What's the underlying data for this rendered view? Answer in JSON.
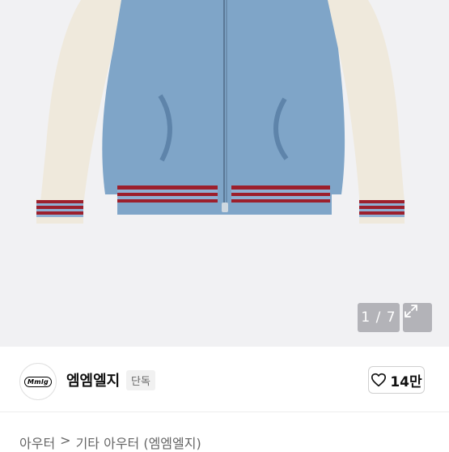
{
  "gallery": {
    "current": "1",
    "separator": " / ",
    "total": "7",
    "counter_text": "1 / 7"
  },
  "seller": {
    "avatar_text": "Mmlg",
    "name": "엠엠엘지",
    "badge": "단독",
    "like_count": "14만"
  },
  "breadcrumb": {
    "category": "아우터",
    "separator": ">",
    "subcategory": "기타 아우터 (엠엠엘지)"
  },
  "icons": {
    "expand": "expand-icon",
    "heart": "heart-outline-icon"
  },
  "colors": {
    "photo_bg": "#f1f1f3",
    "body_knit": "#7fa5c8",
    "sleeve_knit": "#efe9dc",
    "stripe_red": "#9c1f2c",
    "stripe_blue": "#8fb0d3"
  }
}
